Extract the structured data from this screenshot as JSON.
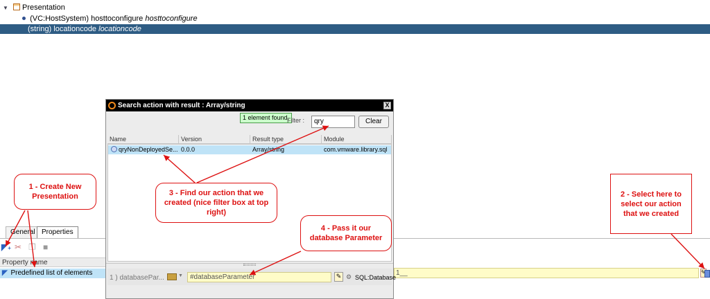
{
  "tree": {
    "root_label": "Presentation",
    "child1_prefix": "(VC:HostSystem) hosttoconfigure",
    "child1_name": "hosttoconfigure",
    "child2_prefix": "(string) locationcode",
    "child2_name": "locationcode"
  },
  "bottom_panel": {
    "tabs": [
      "General",
      "Properties"
    ],
    "column_header": "Property name",
    "property_row": "Predefined list of elements",
    "yellow_field_value": "1__"
  },
  "dialog": {
    "title": "Search action with result : Array/string",
    "close_glyph": "X",
    "found_badge": "1 element found.",
    "filter_label": "Filter :",
    "filter_value": "qry",
    "clear_button": "Clear",
    "columns": [
      "Name",
      "Version",
      "Result type",
      "Module"
    ],
    "rows": [
      {
        "name": "qryNonDeployedSe...",
        "version": "0.0.0",
        "result_type": "Array/string",
        "module": "com.vmware.library.sql"
      }
    ],
    "param": {
      "label": "1 ) databasePar...",
      "value": "#databaseParameter",
      "type": "SQL:Database"
    }
  },
  "callouts": {
    "c1": "1 - Create New Presentation",
    "c2": "2 - Select here to select our action that we created",
    "c3": "3 - Find our action that we created (nice filter box at top right)",
    "c4": "4 - Pass it our database Parameter"
  },
  "colors": {
    "selection": "#2e5c84",
    "callout": "#dd1111",
    "highlight_row": "#bfe3f7",
    "yellow_field": "#fffcc8"
  }
}
